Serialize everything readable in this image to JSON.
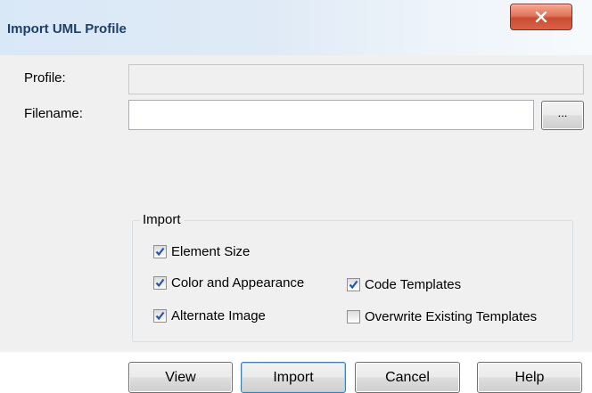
{
  "dialog": {
    "title": "Import UML Profile",
    "close_icon": "close-x-icon"
  },
  "form": {
    "profile_label": "Profile:",
    "profile_value": "",
    "filename_label": "Filename:",
    "filename_value": "",
    "browse_label": "..."
  },
  "import_group": {
    "legend": "Import",
    "options": [
      {
        "label": "Element Size",
        "checked": true
      },
      {
        "label": "Color and Appearance",
        "checked": true
      },
      {
        "label": "Alternate Image",
        "checked": true
      },
      {
        "label": "Code Templates",
        "checked": true
      },
      {
        "label": "Overwrite Existing Templates",
        "checked": false
      }
    ]
  },
  "buttons": {
    "view": "View",
    "import": "Import",
    "cancel": "Cancel",
    "help": "Help"
  },
  "colors": {
    "check_mark": "#2a56a8",
    "close_button": "#c94c31",
    "title_text": "#1e3f66"
  }
}
